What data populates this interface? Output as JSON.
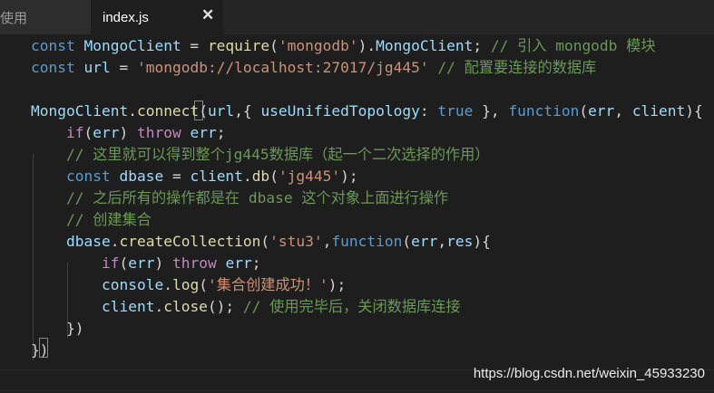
{
  "tabs": {
    "previous_label": "使用",
    "active_label": "index.js",
    "close_glyph": "✕"
  },
  "code_lines": [
    [
      [
        "kw",
        "const "
      ],
      [
        "var",
        "MongoClient"
      ],
      [
        "txt",
        " = "
      ],
      [
        "fn",
        "require"
      ],
      [
        "txt",
        "("
      ],
      [
        "str",
        "'mongodb'"
      ],
      [
        "txt",
        ")."
      ],
      [
        "var",
        "MongoClient"
      ],
      [
        "txt",
        "; "
      ],
      [
        "cm",
        "// 引入 mongodb 模块"
      ]
    ],
    [
      [
        "kw",
        "const "
      ],
      [
        "var",
        "url"
      ],
      [
        "txt",
        " = "
      ],
      [
        "str",
        "'mongodb://localhost:27017/jg445'"
      ],
      [
        "txt",
        " "
      ],
      [
        "cm",
        "// 配置要连接的数据库"
      ]
    ],
    [],
    [
      [
        "var",
        "MongoClient"
      ],
      [
        "txt",
        "."
      ],
      [
        "fn",
        "connect"
      ],
      [
        "txt",
        "("
      ],
      [
        "var",
        "url"
      ],
      [
        "txt",
        ",{ "
      ],
      [
        "var",
        "useUnifiedTopology"
      ],
      [
        "txt",
        ": "
      ],
      [
        "kw",
        "true"
      ],
      [
        "txt",
        " }, "
      ],
      [
        "kw",
        "function"
      ],
      [
        "txt",
        "("
      ],
      [
        "var",
        "err"
      ],
      [
        "txt",
        ", "
      ],
      [
        "var",
        "client"
      ],
      [
        "txt",
        "){"
      ]
    ],
    [
      [
        "txt",
        "    "
      ],
      [
        "ctl",
        "if"
      ],
      [
        "txt",
        "("
      ],
      [
        "var",
        "err"
      ],
      [
        "txt",
        ") "
      ],
      [
        "ctl",
        "throw"
      ],
      [
        "txt",
        " "
      ],
      [
        "var",
        "err"
      ],
      [
        "txt",
        ";"
      ]
    ],
    [
      [
        "txt",
        "    "
      ],
      [
        "cm",
        "// 这里就可以得到整个jg445数据库（起一个二次选择的作用）"
      ]
    ],
    [
      [
        "txt",
        "    "
      ],
      [
        "kw",
        "const "
      ],
      [
        "var",
        "dbase"
      ],
      [
        "txt",
        " = "
      ],
      [
        "var",
        "client"
      ],
      [
        "txt",
        "."
      ],
      [
        "fn",
        "db"
      ],
      [
        "txt",
        "("
      ],
      [
        "str",
        "'jg445'"
      ],
      [
        "txt",
        ");"
      ]
    ],
    [
      [
        "txt",
        "    "
      ],
      [
        "cm",
        "// 之后所有的操作都是在 dbase 这个对象上面进行操作"
      ]
    ],
    [
      [
        "txt",
        "    "
      ],
      [
        "cm",
        "// 创建集合"
      ]
    ],
    [
      [
        "txt",
        "    "
      ],
      [
        "var",
        "dbase"
      ],
      [
        "txt",
        "."
      ],
      [
        "fn",
        "createCollection"
      ],
      [
        "txt",
        "("
      ],
      [
        "str",
        "'stu3'"
      ],
      [
        "txt",
        ","
      ],
      [
        "kw",
        "function"
      ],
      [
        "txt",
        "("
      ],
      [
        "var",
        "err"
      ],
      [
        "txt",
        ","
      ],
      [
        "var",
        "res"
      ],
      [
        "txt",
        "){"
      ]
    ],
    [
      [
        "txt",
        "        "
      ],
      [
        "ctl",
        "if"
      ],
      [
        "txt",
        "("
      ],
      [
        "var",
        "err"
      ],
      [
        "txt",
        ") "
      ],
      [
        "ctl",
        "throw"
      ],
      [
        "txt",
        " "
      ],
      [
        "var",
        "err"
      ],
      [
        "txt",
        ";"
      ]
    ],
    [
      [
        "txt",
        "        "
      ],
      [
        "var",
        "console"
      ],
      [
        "txt",
        "."
      ],
      [
        "fn",
        "log"
      ],
      [
        "txt",
        "("
      ],
      [
        "str",
        "'集合创建成功！'"
      ],
      [
        "txt",
        ");"
      ]
    ],
    [
      [
        "txt",
        "        "
      ],
      [
        "var",
        "client"
      ],
      [
        "txt",
        "."
      ],
      [
        "fn",
        "close"
      ],
      [
        "txt",
        "(); "
      ],
      [
        "cm",
        "// 使用完毕后，关闭数据库连接"
      ]
    ],
    [
      [
        "txt",
        "    })"
      ]
    ],
    [
      [
        "txt",
        "})"
      ]
    ]
  ],
  "watermark": "https://blog.csdn.net/weixin_45933230"
}
